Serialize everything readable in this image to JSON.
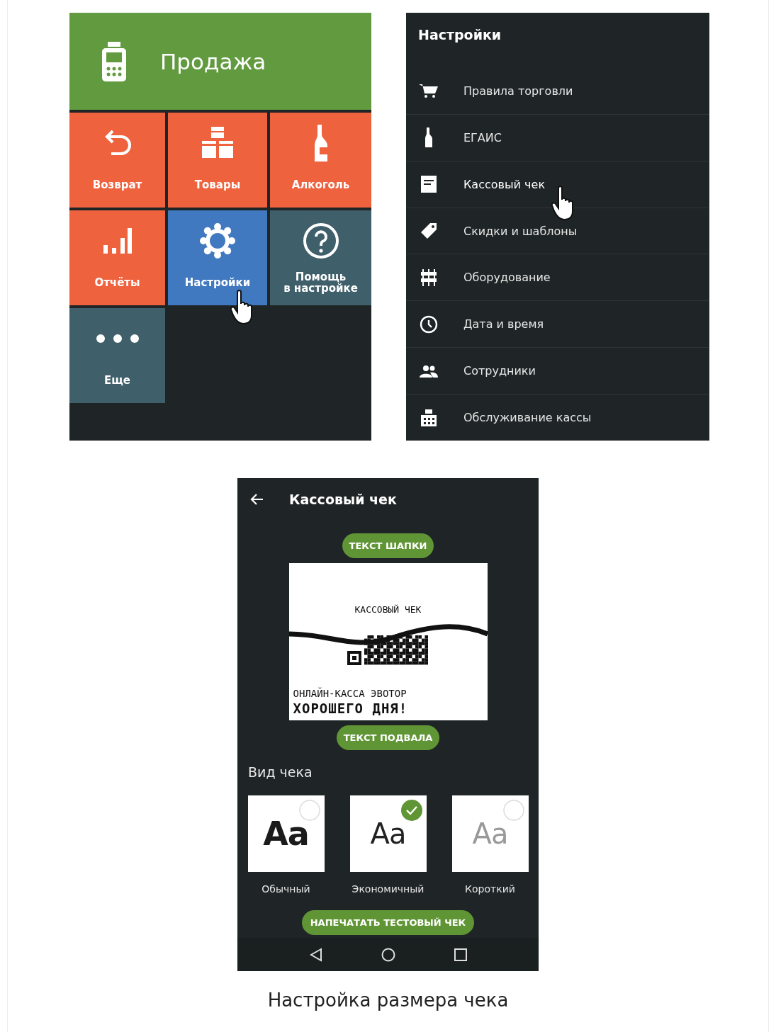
{
  "main_menu": {
    "header": {
      "title": "Продажа"
    },
    "tiles": [
      {
        "label": "Возврат",
        "kind": "return",
        "color": "#ee623e",
        "selected": false
      },
      {
        "label": "Товары",
        "kind": "boxes",
        "color": "#ee623e",
        "selected": false
      },
      {
        "label": "Алкоголь",
        "kind": "bottle",
        "color": "#ee623e",
        "selected": false
      },
      {
        "label": "Отчёты",
        "kind": "bars",
        "color": "#ee623e",
        "selected": false
      },
      {
        "label": "Настройки",
        "kind": "gear",
        "color": "#4179c1",
        "selected": true
      },
      {
        "label": "Помощь\nв настройке",
        "kind": "help",
        "color": "#3f5f6a",
        "selected": false
      },
      {
        "label": "Еще",
        "kind": "dots",
        "color": "#3f5f6a",
        "selected": false
      }
    ]
  },
  "settings": {
    "title": "Настройки",
    "items": [
      {
        "label": "Правила торговли",
        "kind": "cart",
        "selected": false
      },
      {
        "label": "ЕГАИС",
        "kind": "bottle",
        "selected": false
      },
      {
        "label": "Кассовый чек",
        "kind": "receipt",
        "selected": true
      },
      {
        "label": "Скидки и шаблоны",
        "kind": "tag",
        "selected": false
      },
      {
        "label": "Оборудование",
        "kind": "equipment",
        "selected": false
      },
      {
        "label": "Дата и время",
        "kind": "clock",
        "selected": false
      },
      {
        "label": "Сотрудники",
        "kind": "people",
        "selected": false
      },
      {
        "label": "Обслуживание кассы",
        "kind": "register",
        "selected": false
      }
    ]
  },
  "receipt_screen": {
    "title": "Кассовый чек",
    "header_button": "ТЕКСТ ШАПКИ",
    "preview": {
      "heading": "КАССОВЫЙ ЧЕК",
      "line_1": "ОНЛАЙН-КАССА ЭВОТОР",
      "line_2": "ХОРОШЕГО ДНЯ!"
    },
    "footer_button": "ТЕКСТ ПОДВАЛА",
    "section_title": "Вид чека",
    "styles": [
      {
        "sample": "Aa",
        "label": "Обычный",
        "kind": "bold",
        "selected": false
      },
      {
        "sample": "Aa",
        "label": "Экономичный",
        "kind": "regular",
        "selected": true
      },
      {
        "sample": "Aa",
        "label": "Короткий",
        "kind": "light",
        "selected": false
      }
    ],
    "print_button": "НАПЕЧАТАТЬ ТЕСТОВЫЙ ЧЕК"
  },
  "caption": "Настройка размера чека"
}
